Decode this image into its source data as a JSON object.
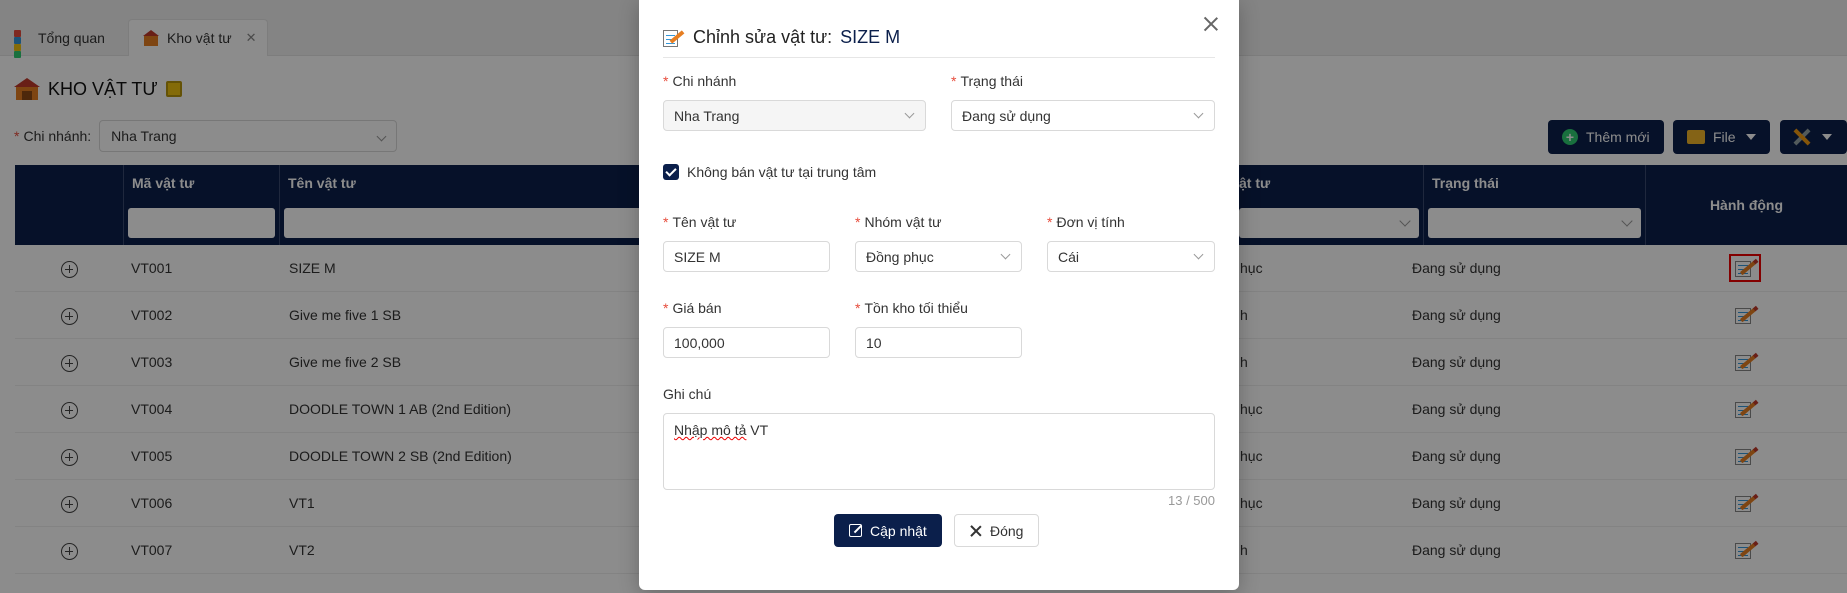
{
  "tabs": [
    {
      "label": "Tổng quan"
    },
    {
      "label": "Kho vật tư"
    }
  ],
  "page": {
    "title": "KHO VẬT TƯ",
    "branch_label": "Chi nhánh:",
    "branch_value": "Nha Trang"
  },
  "toolbar": {
    "add_label": "Thêm mới",
    "file_label": "File"
  },
  "table": {
    "columns": [
      "Mã vật tư",
      "Tên vật tư",
      "ật tư",
      "Trạng thái",
      "Hành động"
    ],
    "rows": [
      {
        "code": "VT001",
        "name": "SIZE M",
        "group": "hục",
        "status": "Đang sử dụng"
      },
      {
        "code": "VT002",
        "name": "Give me five 1 SB",
        "group": "h",
        "status": "Đang sử dụng"
      },
      {
        "code": "VT003",
        "name": "Give me five 2 SB",
        "group": "h",
        "status": "Đang sử dụng"
      },
      {
        "code": "VT004",
        "name": "DOODLE TOWN 1 AB (2nd Edition)",
        "group": "hục",
        "status": "Đang sử dụng"
      },
      {
        "code": "VT005",
        "name": "DOODLE TOWN 2 SB (2nd Edition)",
        "group": "hục",
        "status": "Đang sử dụng"
      },
      {
        "code": "VT006",
        "name": "VT1",
        "group": "hục",
        "status": "Đang sử dụng"
      },
      {
        "code": "VT007",
        "name": "VT2",
        "group": "h",
        "status": "Đang sử dụng"
      }
    ]
  },
  "modal": {
    "title_prefix": "Chỉnh sửa vật tư:",
    "title_name": "SIZE M",
    "branch": {
      "label": "Chi nhánh",
      "value": "Nha Trang"
    },
    "status": {
      "label": "Trạng thái",
      "value": "Đang sử dụng"
    },
    "no_sell_label": "Không bán vật tư tại trung tâm",
    "name": {
      "label": "Tên vật tư",
      "value": "SIZE M"
    },
    "group": {
      "label": "Nhóm vật tư",
      "value": "Đồng phục"
    },
    "unit": {
      "label": "Đơn vị tính",
      "value": "Cái"
    },
    "price": {
      "label": "Giá bán",
      "value": "100,000"
    },
    "min_stock": {
      "label": "Tồn kho tối thiểu",
      "value": "10"
    },
    "note": {
      "label": "Ghi chú",
      "value_a": "Nhập mô tả",
      "value_b": " VT",
      "counter": "13 / 500"
    },
    "update_label": "Cập nhật",
    "close_label": "Đóng"
  },
  "colors": {
    "primary": "#0b1f4b",
    "required": "#e74c3c"
  }
}
